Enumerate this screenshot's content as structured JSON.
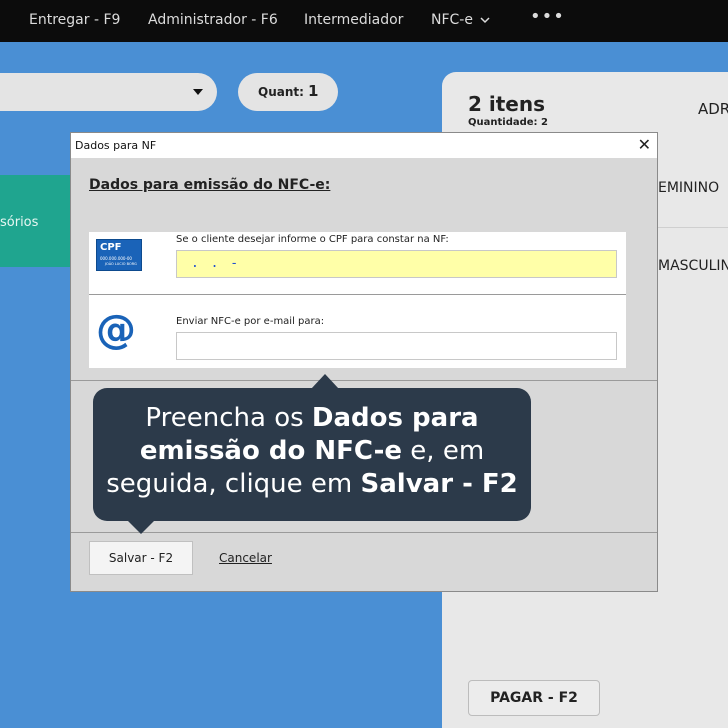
{
  "nav": {
    "items": [
      "Entregar - F9",
      "Administrador - F6",
      "Intermediador",
      "NFC-e"
    ],
    "more": "•••"
  },
  "background": {
    "quant_label": "Quant:",
    "quant_value": "1",
    "tile_label": "sórios",
    "panel_items": "2 itens",
    "panel_qty": "Quantidade: 2",
    "panel_header_right": "ADR",
    "rows": [
      "EMININO",
      "MASCULIN"
    ],
    "pay_button": "PAGAR - F2"
  },
  "dialog": {
    "title": "Dados para NF",
    "close": "✕",
    "heading": "Dados para emissão do NFC-e:",
    "cpf_badge_title": "CPF",
    "cpf_badge_number": "000.000.000-00",
    "cpf_badge_name": "JOÃO LUCIO BORG",
    "cpf_label": "Se o cliente desejar informe o CPF para constar na NF:",
    "cpf_value": ". . -",
    "email_icon": "@",
    "email_label": "Enviar NFC-e por e-mail para:",
    "email_value": "",
    "save_button": "Salvar - F2",
    "cancel_link": "Cancelar"
  },
  "tooltip": {
    "line1_pre": "Preencha os ",
    "line1_bold": "Dados para",
    "line2_bold": "emissão do NFC-e",
    "line2_post": " e, em",
    "line3_pre": "seguida, clique em ",
    "line3_bold": "Salvar - F2"
  },
  "colors": {
    "background": "#4a8fd4",
    "topnav": "#0c0c0c",
    "tooltip": "#2c3a4a",
    "accent_green": "#1fa58f",
    "cpf_field": "#ffffa8",
    "brand_blue": "#1a63b8"
  }
}
